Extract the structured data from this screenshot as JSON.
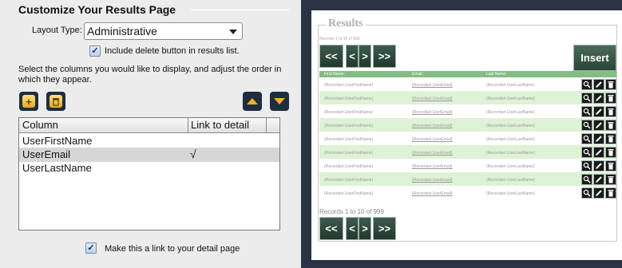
{
  "panel": {
    "title": "Customize Your Results Page",
    "layout_type_label": "Layout Type:",
    "layout_type_value": "Administrative",
    "include_delete_label": "Include delete button in results list.",
    "include_delete_checked": "✓",
    "instructions": "Select the columns you would like to display, and adjust the order in which they appear.",
    "columns_header": "Column",
    "link_header": "Link to detail",
    "columns": [
      {
        "name": "UserFirstName",
        "link": ""
      },
      {
        "name": "UserEmail",
        "link": "√"
      },
      {
        "name": "UserLastName",
        "link": ""
      }
    ],
    "make_link_label": "Make this a link to your detail page",
    "make_link_checked": "✓",
    "icons": {
      "add": "add-icon",
      "delete": "trash-icon",
      "up": "arrow-up-icon",
      "down": "arrow-down-icon"
    }
  },
  "preview": {
    "title": "Results",
    "records_top": "Records 1 to 10 of 999",
    "records_bottom": "Records 1 to 10 of 999",
    "nav": {
      "first": "<<",
      "prev": "<",
      "next": ">",
      "last": ">>"
    },
    "insert_label": "Insert",
    "headers": {
      "first": "First Name:",
      "email": "Email:",
      "last": "Last Name:"
    },
    "rows": [
      {
        "first": "{Recordset.UserFirstName}",
        "email": "{Recordset.UserEmail}",
        "last": "{Recordset.UserLastName}"
      },
      {
        "first": "{Recordset.UserFirstName}",
        "email": "{Recordset.UserEmail}",
        "last": "{Recordset.UserLastName}"
      },
      {
        "first": "{Recordset.UserFirstName}",
        "email": "{Recordset.UserEmail}",
        "last": "{Recordset.UserLastName}"
      },
      {
        "first": "{Recordset.UserFirstName}",
        "email": "{Recordset.UserEmail}",
        "last": "{Recordset.UserLastName}"
      },
      {
        "first": "{Recordset.UserFirstName}",
        "email": "{Recordset.UserEmail}",
        "last": "{Recordset.UserLastName}"
      },
      {
        "first": "{Recordset.UserFirstName}",
        "email": "{Recordset.UserEmail}",
        "last": "{Recordset.UserLastName}"
      },
      {
        "first": "{Recordset.UserFirstName}",
        "email": "{Recordset.UserEmail}",
        "last": "{Recordset.UserLastName}"
      },
      {
        "first": "{Recordset.UserFirstName}",
        "email": "{Recordset.UserEmail}",
        "last": "{Recordset.UserLastName}"
      },
      {
        "first": "{Recordset.UserFirstName}",
        "email": "{Recordset.UserEmail}",
        "last": "{Recordset.UserLastName}"
      }
    ],
    "row_actions": [
      "view-icon",
      "edit-icon",
      "delete-icon"
    ],
    "colors": {
      "header_green": "#84bd84",
      "row_green": "#def2d5",
      "button_green": "#2b4436"
    }
  }
}
